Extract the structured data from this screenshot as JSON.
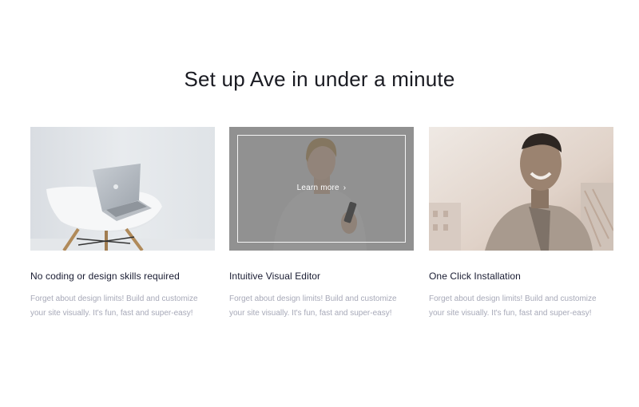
{
  "section": {
    "title": "Set up Ave in under a minute"
  },
  "cards": [
    {
      "image_alt": "Laptop on white chair",
      "title": "No coding or design skills required",
      "description": "Forget about design limits! Build and customize your site visually. It's fun, fast and super-easy!"
    },
    {
      "image_alt": "Woman holding phone",
      "hover_link": "Learn more",
      "title": "Intuitive Visual Editor",
      "description": "Forget about design limits! Build and customize your site visually. It's fun, fast and super-easy!"
    },
    {
      "image_alt": "Smiling man double exposure",
      "title": "One Click Installation",
      "description": "Forget about design limits! Build and customize your site visually. It's fun, fast and super-easy!"
    }
  ],
  "colors": {
    "heading": "#1a1b22",
    "card_title": "#181b31",
    "body_text": "#a7a9b8",
    "overlay": "#5a5a5a"
  },
  "icons": {
    "learn_more_chevron": "chevron-right-icon"
  }
}
